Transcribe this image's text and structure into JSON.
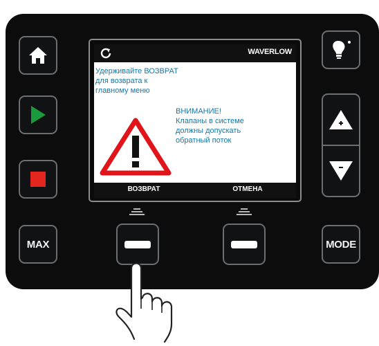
{
  "screen": {
    "model": "WAVERLOW",
    "message": [
      "Удерживайте ВОЗВРАТ",
      "для возврата к",
      "главному меню"
    ],
    "warning_title": "ВНИМАНИЕ!",
    "warning_lines": [
      "Клапаны в системе",
      "должны допускать",
      "обратный поток"
    ],
    "softkey_left_label": "ВОЗВРАТ",
    "softkey_right_label": "ОТМЕНА"
  },
  "buttons": {
    "max_label": "MAX",
    "mode_label": "MODE"
  },
  "icons": {
    "home": "home-icon",
    "play": "play-icon",
    "stop": "stop-icon",
    "light": "lightbulb-icon",
    "up": "arrow-up-plus-icon",
    "down": "arrow-down-minus-icon",
    "refresh": "refresh-icon",
    "warning": "warning-icon",
    "hand": "pointing-hand-icon"
  },
  "colors": {
    "panel": "#0c0c0d",
    "play": "#1a9a3c",
    "stop": "#e3261e",
    "screen_text": "#1378a8",
    "warning": "#e0151b"
  }
}
